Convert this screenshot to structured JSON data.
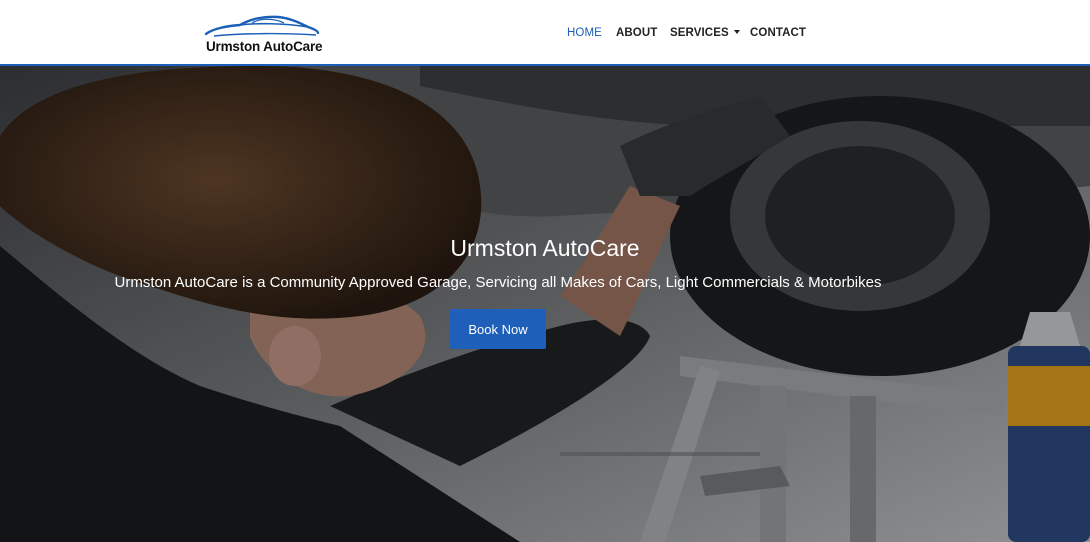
{
  "brand": {
    "name": "Urmston AutoCare",
    "logo_icon": "car-silhouette-icon",
    "logo_color": "#1b5fb8"
  },
  "nav": {
    "items": [
      {
        "label": "HOME",
        "active": true
      },
      {
        "label": "ABOUT",
        "active": false
      },
      {
        "label": "SERVICES",
        "active": false,
        "has_dropdown": true
      },
      {
        "label": "CONTACT",
        "active": false
      }
    ]
  },
  "hero": {
    "title": "Urmston AutoCare",
    "subtitle": "Urmston AutoCare is a Community Approved Garage, Servicing all Makes of Cars, Light Commercials & Motorbikes",
    "cta_label": "Book Now"
  },
  "colors": {
    "accent": "#1b5fb8",
    "button": "#1d5fb9",
    "header_bg": "#ffffff",
    "nav_text": "#222222"
  }
}
